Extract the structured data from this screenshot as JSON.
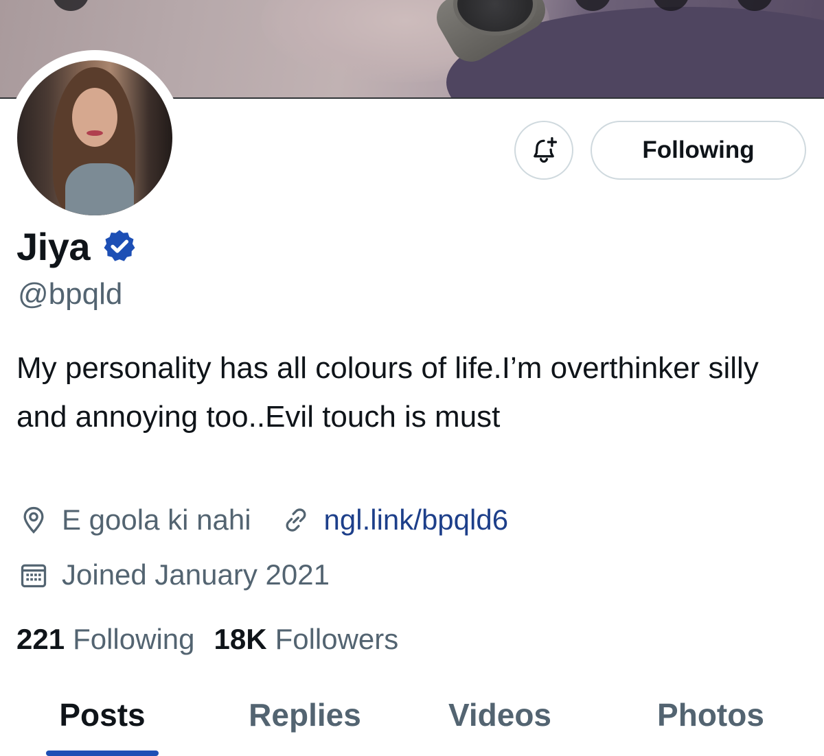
{
  "profile": {
    "display_name": "Jiya",
    "handle": "@bpqld",
    "bio": "My personality has all colours of life.I’m overthinker silly and annoying too..Evil touch is must",
    "location": "E goola ki nahi",
    "link": "ngl.link/bpqld6",
    "joined": "Joined January 2021",
    "verified": true
  },
  "actions": {
    "notify_icon": "bell-plus-icon",
    "following_label": "Following"
  },
  "stats": {
    "following_count": "221",
    "following_label": "Following",
    "followers_count": "18K",
    "followers_label": "Followers"
  },
  "tabs": [
    {
      "label": "Posts",
      "active": true
    },
    {
      "label": "Replies",
      "active": false
    },
    {
      "label": "Videos",
      "active": false
    },
    {
      "label": "Photos",
      "active": false
    }
  ],
  "icons": {
    "location": "location-pin-icon",
    "link": "link-icon",
    "calendar": "calendar-icon",
    "verified": "verified-badge-icon"
  },
  "colors": {
    "text_primary": "#0f1419",
    "text_secondary": "#536471",
    "link": "#1d3f8a",
    "verified_badge": "#1d4fb5",
    "tab_indicator": "#1d4fb5",
    "button_border": "#cfd9de"
  }
}
